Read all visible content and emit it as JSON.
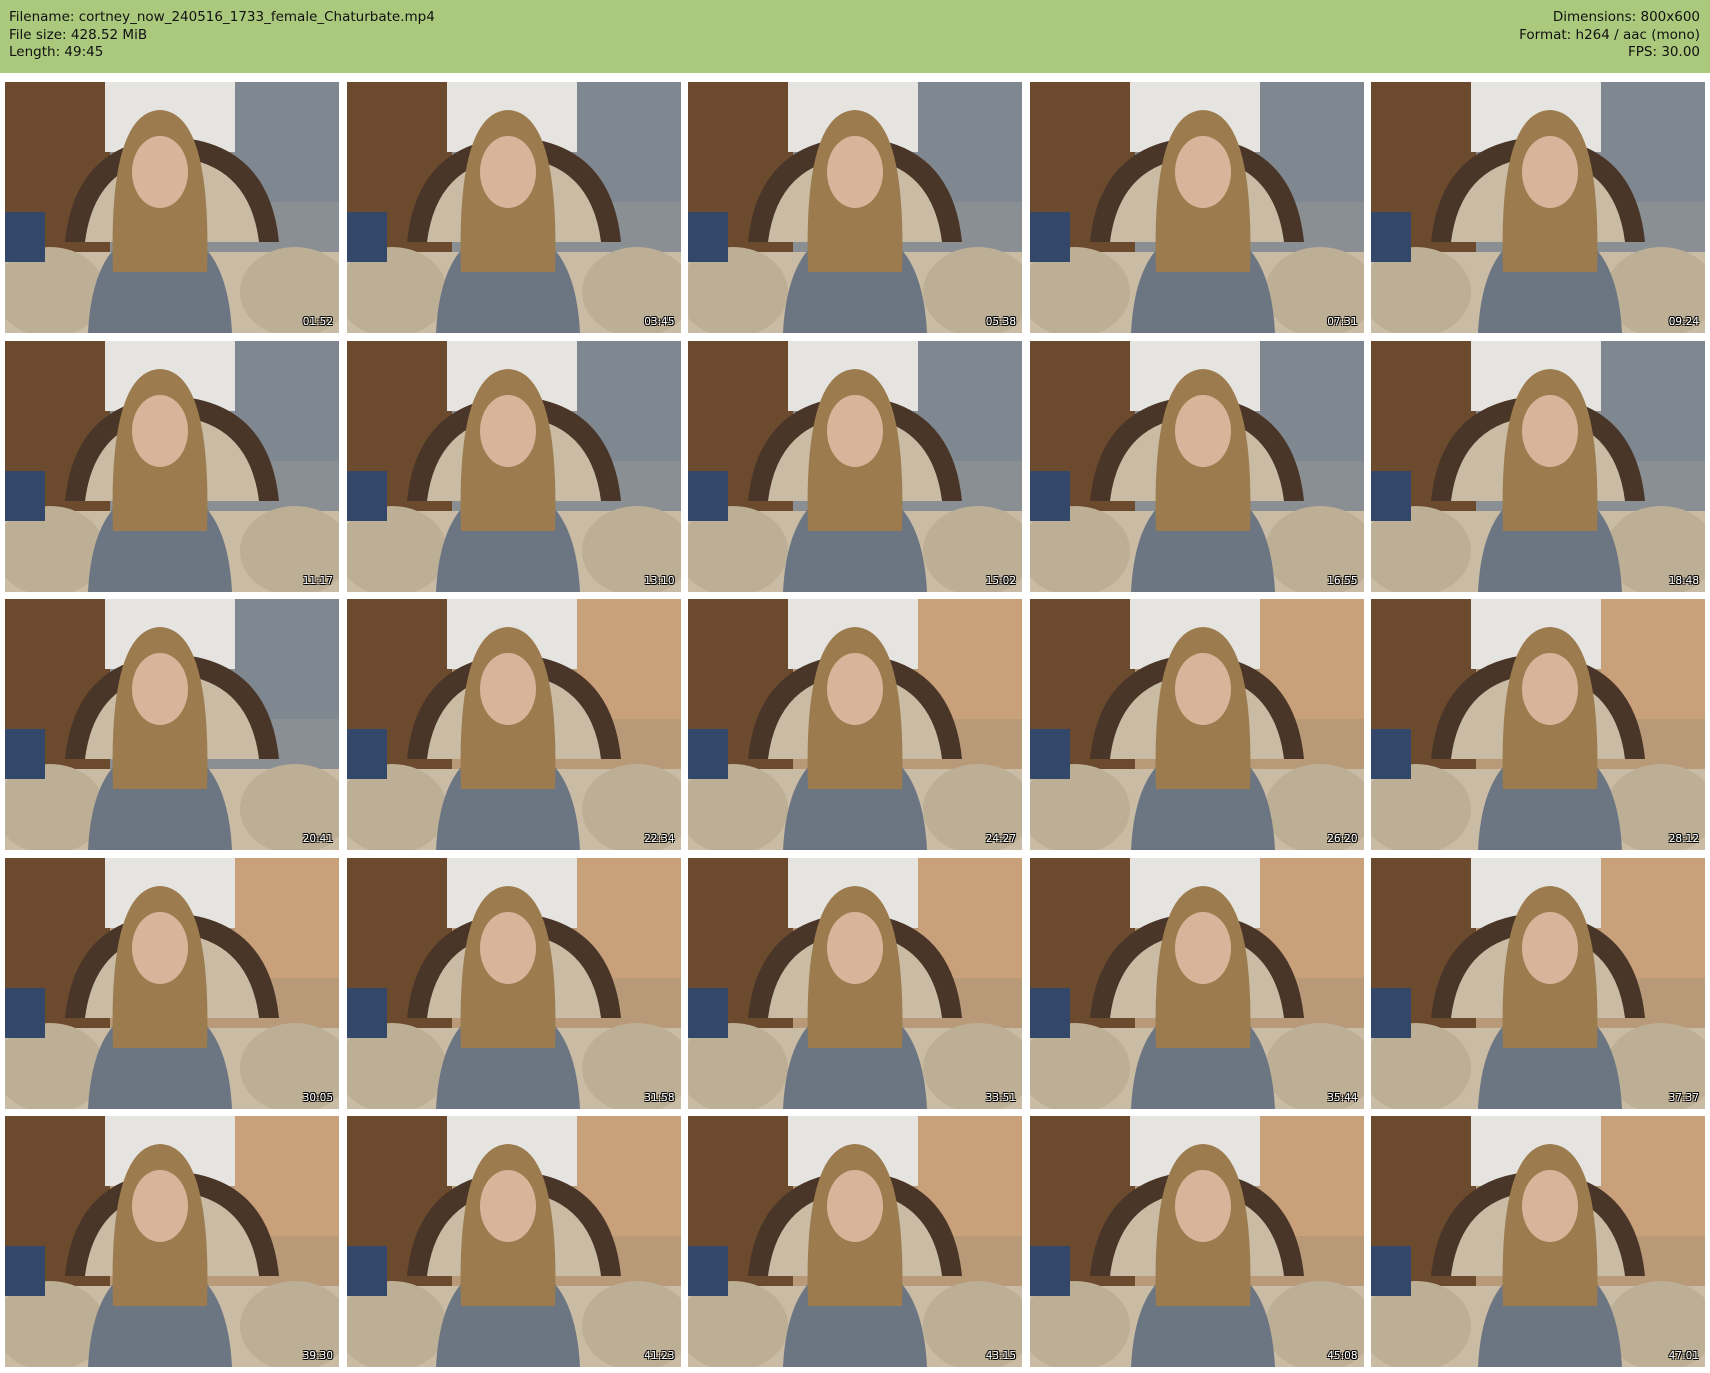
{
  "header": {
    "filename_label": "Filename: cortney_now_240516_1733_female_Chaturbate.mp4",
    "filesize_label": "File size: 428.52 MiB",
    "length_label": "Length: 49:45",
    "dimensions_label": "Dimensions: 800x600",
    "format_label": "Format: h264 / aac (mono)",
    "fps_label": "FPS: 30.00"
  },
  "colors": {
    "header_bg": "#abc97d",
    "cool_wall": "#8a8f94",
    "warm_wall": "#b89a78",
    "door": "#6b4a2e",
    "chair_frame": "#4a3628",
    "chair_fabric": "#c9bba4",
    "hair": "#9c7c4e",
    "sweater": "#6c7682",
    "skin": "#d8b49a",
    "curtain": "#e6e4e0"
  },
  "thumbnails": [
    {
      "timestamp": "01:52",
      "tone": "cool"
    },
    {
      "timestamp": "03:45",
      "tone": "cool"
    },
    {
      "timestamp": "05:38",
      "tone": "cool"
    },
    {
      "timestamp": "07:31",
      "tone": "cool"
    },
    {
      "timestamp": "09:24",
      "tone": "cool"
    },
    {
      "timestamp": "11:17",
      "tone": "cool"
    },
    {
      "timestamp": "13:10",
      "tone": "cool"
    },
    {
      "timestamp": "15:02",
      "tone": "cool"
    },
    {
      "timestamp": "16:55",
      "tone": "cool"
    },
    {
      "timestamp": "18:48",
      "tone": "cool"
    },
    {
      "timestamp": "20:41",
      "tone": "cool"
    },
    {
      "timestamp": "22:34",
      "tone": "warm"
    },
    {
      "timestamp": "24:27",
      "tone": "warm"
    },
    {
      "timestamp": "26:20",
      "tone": "warm"
    },
    {
      "timestamp": "28:12",
      "tone": "warm"
    },
    {
      "timestamp": "30:05",
      "tone": "warm"
    },
    {
      "timestamp": "31:58",
      "tone": "warm"
    },
    {
      "timestamp": "33:51",
      "tone": "warm"
    },
    {
      "timestamp": "35:44",
      "tone": "warm"
    },
    {
      "timestamp": "37:37",
      "tone": "warm"
    },
    {
      "timestamp": "39:30",
      "tone": "warm"
    },
    {
      "timestamp": "41:23",
      "tone": "warm"
    },
    {
      "timestamp": "43:15",
      "tone": "warm"
    },
    {
      "timestamp": "45:08",
      "tone": "warm"
    },
    {
      "timestamp": "47:01",
      "tone": "warm"
    }
  ]
}
